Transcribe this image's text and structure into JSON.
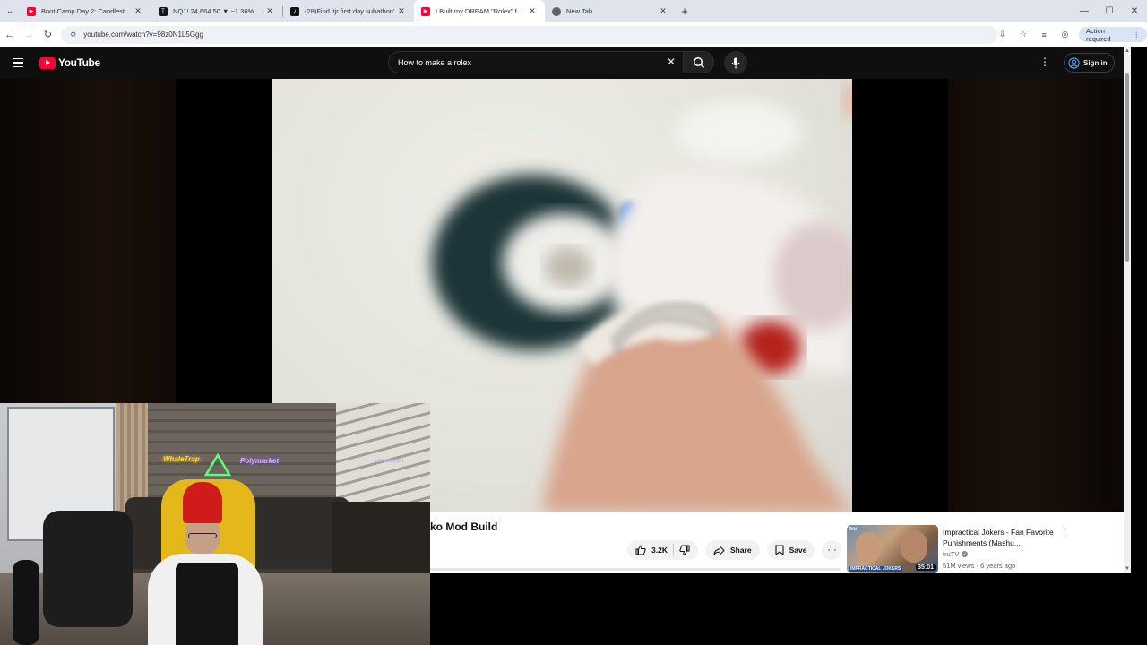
{
  "browser": {
    "tabs": [
      {
        "title": "Boot Camp Day 2: Candlesticks",
        "icon": "youtube-icon",
        "color": "#ff0033",
        "active": false
      },
      {
        "title": "NQ1! 24,664.50 ▼ −1.36% MAC",
        "icon": "tradingview-icon",
        "color": "#131722",
        "active": false
      },
      {
        "title": "(28)Find 'tjr first day subathon'",
        "icon": "tiktok-icon",
        "color": "#111111",
        "active": false
      },
      {
        "title": "I Built my DREAM \"Rolex\" for $",
        "icon": "youtube-icon",
        "color": "#ff0033",
        "active": true
      },
      {
        "title": "New Tab",
        "icon": "chrome-icon",
        "color": "#5f6368",
        "active": false
      }
    ],
    "url": "youtube.com/watch?v=98z0N1L5Ggg",
    "action_required": "Action required"
  },
  "youtube": {
    "logo_text": "YouTube",
    "search_value": "How to make a rolex",
    "sign_in": "Sign in",
    "video_title": "ko Mod Build",
    "like_count": "3.2K",
    "share_label": "Share",
    "save_label": "Save",
    "recommendation": {
      "title": "Impractical Jokers - Fan Favorite Punishments (Mashu...",
      "channel": "truTV",
      "meta": "51M views · 6 years ago",
      "duration": "35:01",
      "thumb_brand": "tru",
      "thumb_show": "IMPRACTICAL JOKERS"
    }
  },
  "webcam": {
    "neon_1": "WhaleTrap",
    "neon_2": "Polymarket",
    "neon_3": "Polymarket"
  },
  "colors": {
    "yt_red": "#ff0033",
    "yt_header": "#0f0f0f",
    "tabstrip": "#dfe3eb"
  }
}
